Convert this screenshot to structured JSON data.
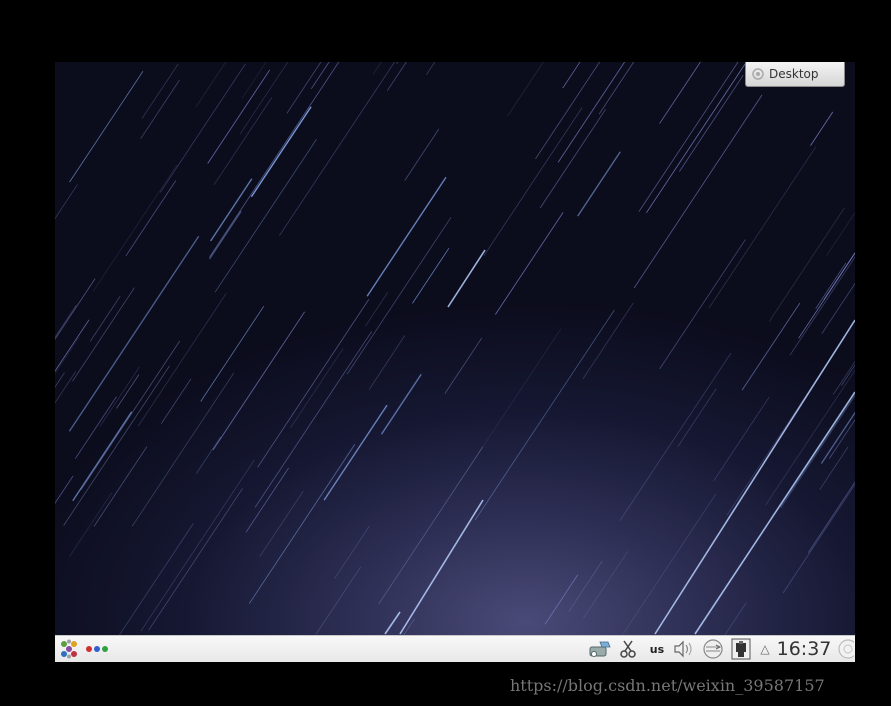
{
  "desktop_widget": {
    "label": "Desktop",
    "icon": "plasma-icon"
  },
  "panel": {
    "launcher_icon": "kickoff-launcher-icon",
    "pager_colors": [
      "#d03030",
      "#3060d0",
      "#30a040"
    ],
    "tray": {
      "keyboard_layout": "us",
      "clock": "16:37"
    }
  },
  "watermark": "https://blog.csdn.net/weixin_39587157"
}
